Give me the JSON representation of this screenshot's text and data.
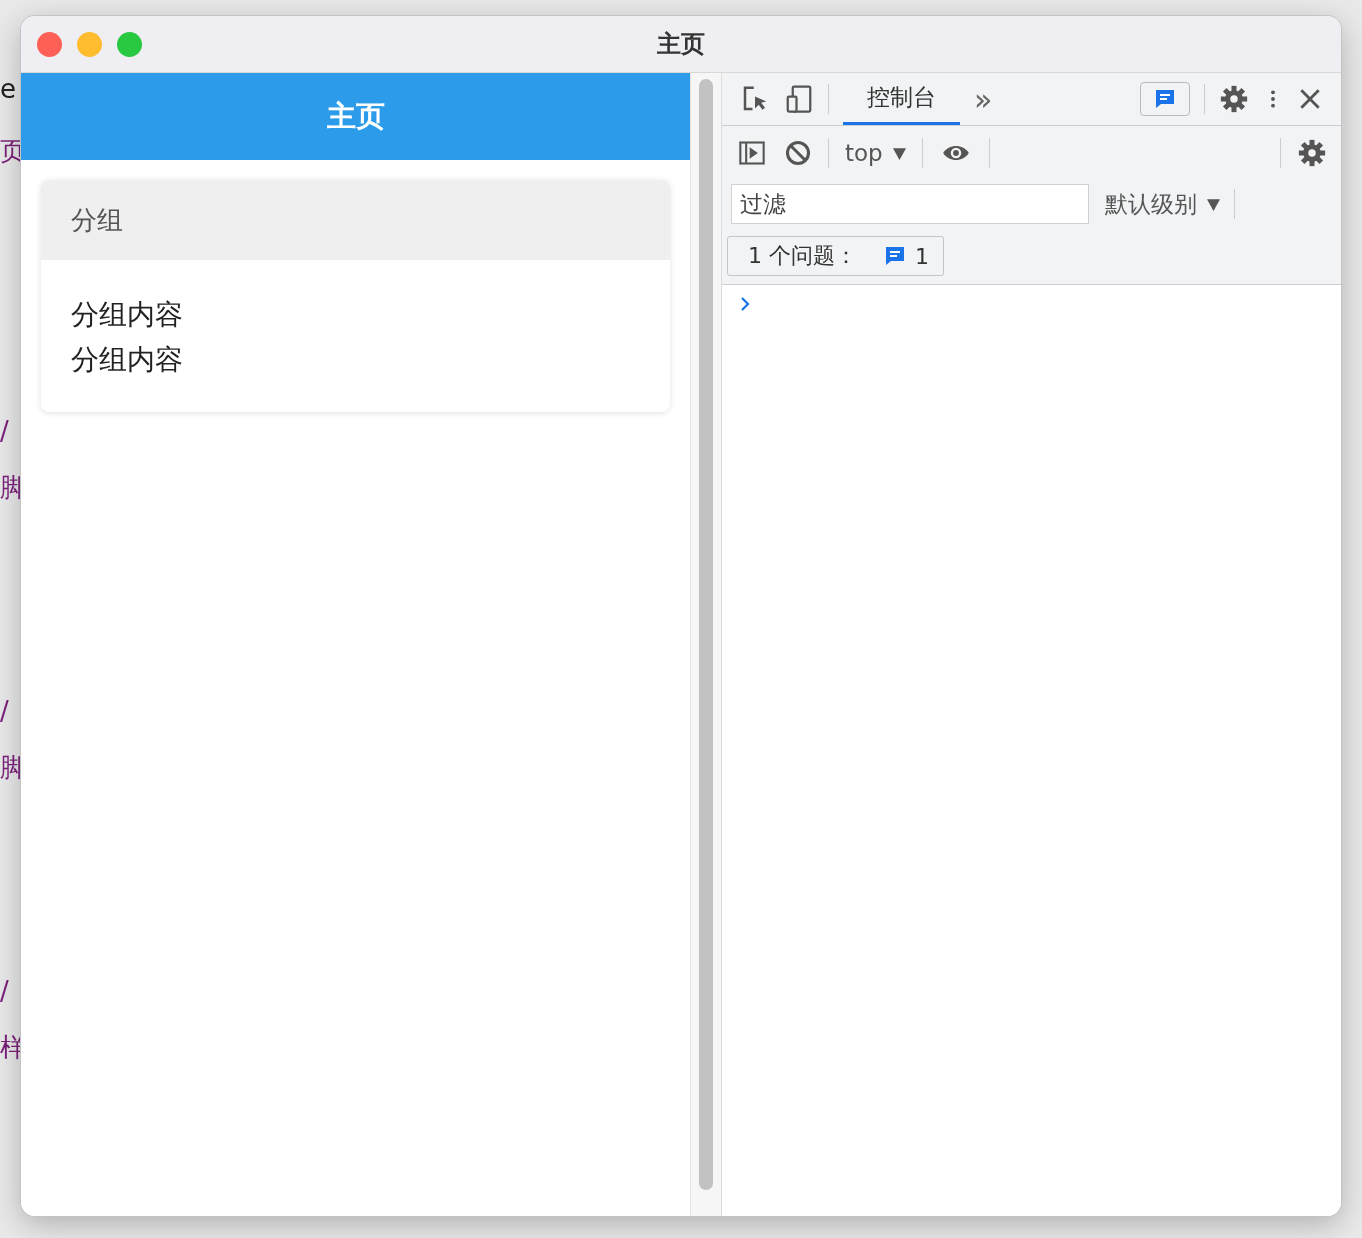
{
  "background_app": {
    "fragments": [
      "e",
      "页",
      "/",
      "脚",
      "/",
      "脚",
      "/",
      "样"
    ]
  },
  "window": {
    "title": "主页"
  },
  "app": {
    "header": "主页",
    "group": {
      "title": "分组",
      "lines": [
        "分组内容",
        "分组内容"
      ]
    }
  },
  "devtools": {
    "tabs": [
      {
        "label": "控制台",
        "selected": true
      }
    ],
    "more": "»",
    "context": "top",
    "filter": {
      "placeholder": "过滤"
    },
    "level_menu": "默认级别",
    "issues": {
      "label": "1 个问题：",
      "count": "1"
    }
  }
}
